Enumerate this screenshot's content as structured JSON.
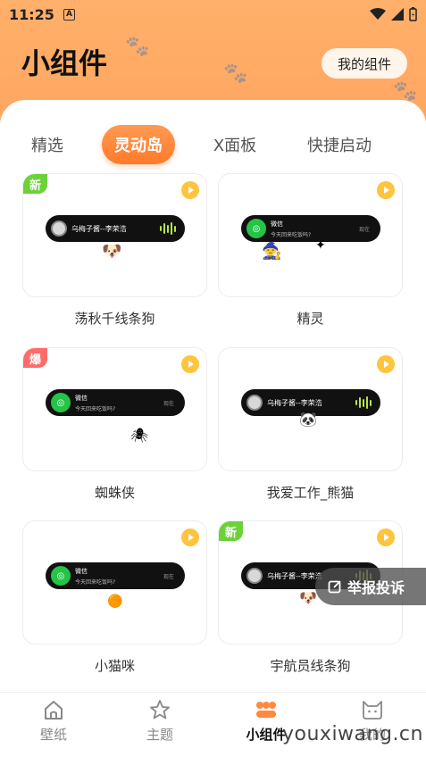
{
  "status_bar": {
    "time": "11:25",
    "notification_glyph": "A"
  },
  "header": {
    "title": "小组件",
    "my_widgets_label": "我的组件"
  },
  "tabs": [
    {
      "label": "精选"
    },
    {
      "label": "灵动岛"
    },
    {
      "label": "X面板"
    },
    {
      "label": "快捷启动"
    }
  ],
  "cards": [
    {
      "title": "荡秋千线条狗",
      "badge": "新",
      "island_type": "music",
      "island_text": "乌梅子酱--李荣浩"
    },
    {
      "title": "精灵",
      "badge": "",
      "island_type": "wechat",
      "island_line1": "微信",
      "island_line2": "今天回来吃饭吗?",
      "island_time": "现在"
    },
    {
      "title": "蜘蛛侠",
      "badge": "爆",
      "island_type": "wechat",
      "island_line1": "微信",
      "island_line2": "今天回来吃饭吗?",
      "island_time": "现在"
    },
    {
      "title": "我爱工作_熊猫",
      "badge": "",
      "island_type": "music",
      "island_text": "乌梅子酱--李荣浩"
    },
    {
      "title": "小猫咪",
      "badge": "",
      "island_type": "wechat",
      "island_line1": "微信",
      "island_line2": "今天回来吃饭吗?",
      "island_time": "现在"
    },
    {
      "title": "宇航员线条狗",
      "badge": "新",
      "island_type": "music",
      "island_text": "乌梅子酱--李荣浩"
    }
  ],
  "report_label": "举报投诉",
  "bottom_nav": [
    {
      "label": "壁纸",
      "icon": "home-icon"
    },
    {
      "label": "主题",
      "icon": "star-icon"
    },
    {
      "label": "小组件",
      "icon": "widgets-icon"
    },
    {
      "label": "我的",
      "icon": "cat-icon"
    }
  ],
  "watermark": "youxiwang.cn",
  "colors": {
    "accent": "#ff8a3d",
    "header": "#ffa862",
    "new_badge": "#6dd23a",
    "hot_badge": "#ff6b6b",
    "play": "#ffc43d"
  }
}
